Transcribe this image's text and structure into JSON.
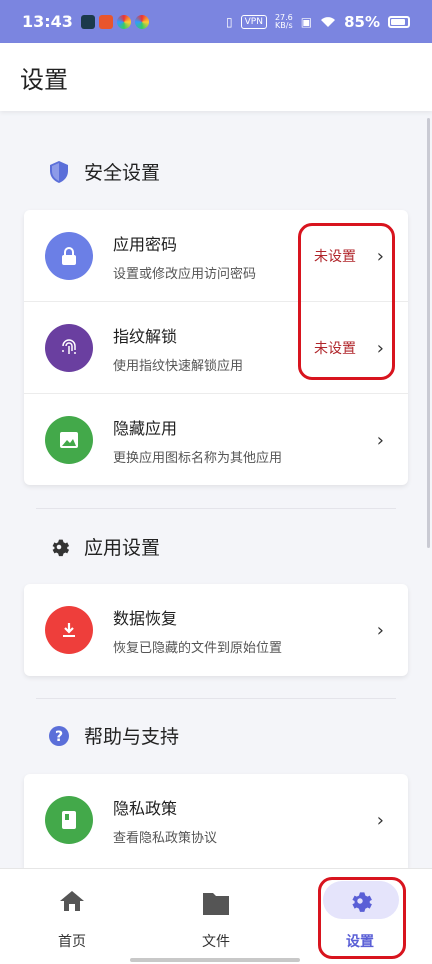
{
  "status_bar": {
    "time": "13:43",
    "vpn": "VPN",
    "speed_value": "27.6",
    "speed_unit": "KB/s",
    "battery": "85%"
  },
  "header": {
    "title": "设置"
  },
  "sections": {
    "security": {
      "title": "安全设置",
      "items": [
        {
          "title": "应用密码",
          "subtitle": "设置或修改应用访问密码",
          "status": "未设置",
          "icon": "lock-icon",
          "color": "#6b7fe6"
        },
        {
          "title": "指纹解锁",
          "subtitle": "使用指纹快速解锁应用",
          "status": "未设置",
          "icon": "fingerprint-icon",
          "color": "#6a3fa0"
        },
        {
          "title": "隐藏应用",
          "subtitle": "更换应用图标名称为其他应用",
          "status": "",
          "icon": "image-icon",
          "color": "#43a94a"
        }
      ]
    },
    "app": {
      "title": "应用设置",
      "items": [
        {
          "title": "数据恢复",
          "subtitle": "恢复已隐藏的文件到原始位置",
          "icon": "download-icon",
          "color": "#ee3e3b"
        }
      ]
    },
    "help": {
      "title": "帮助与支持",
      "items": [
        {
          "title": "隐私政策",
          "subtitle": "查看隐私政策协议",
          "icon": "book-icon",
          "color": "#43a94a"
        }
      ]
    }
  },
  "bottom_nav": {
    "items": [
      {
        "label": "首页",
        "icon": "home-icon"
      },
      {
        "label": "文件",
        "icon": "folder-icon"
      },
      {
        "label": "设置",
        "icon": "gear-icon",
        "active": true
      }
    ],
    "accent": "#5a5fd6"
  },
  "colors": {
    "status_bar": "#7b85e0",
    "status_text": "#b0262b",
    "highlight": "#d8141e"
  }
}
